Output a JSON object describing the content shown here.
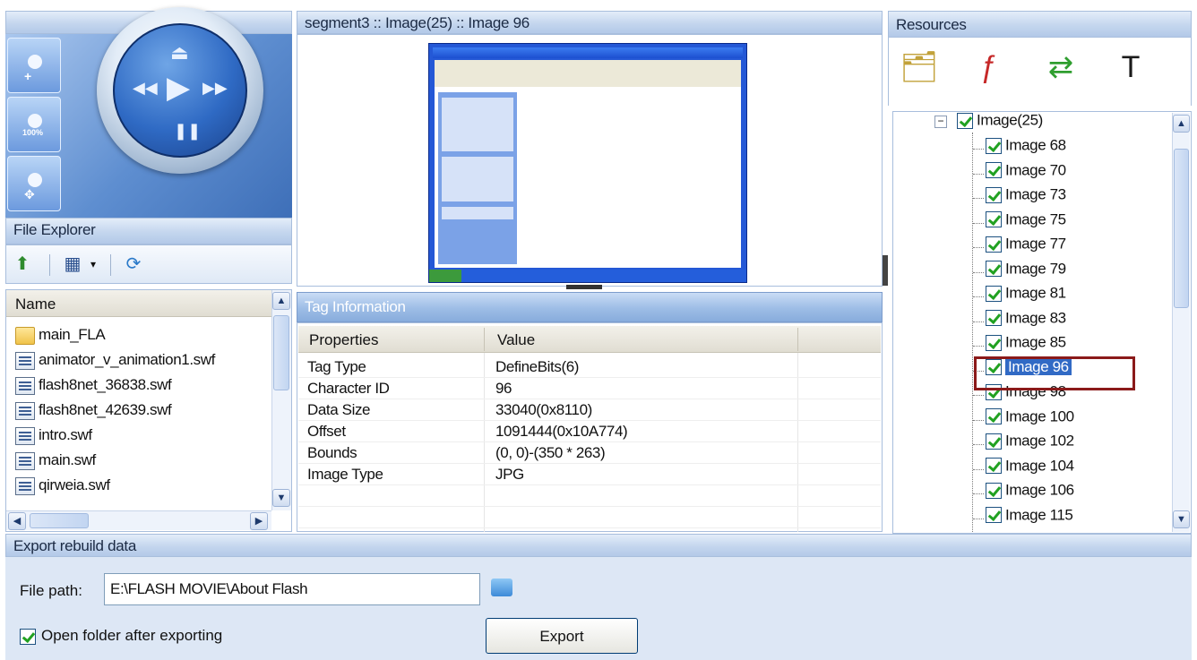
{
  "preview": {
    "title": "segment3 :: Image(25) :: Image 96"
  },
  "resources": {
    "title": "Resources",
    "toolbar_icons": [
      "open-folder-icon",
      "flash-file-icon",
      "refresh-swap-icon",
      "text-properties-icon"
    ],
    "tree": {
      "root_label": "Image(25)",
      "items": [
        "Image 68",
        "Image 70",
        "Image 73",
        "Image 75",
        "Image 77",
        "Image 79",
        "Image 81",
        "Image 83",
        "Image 85",
        "Image 96",
        "Image 98",
        "Image 100",
        "Image 102",
        "Image 104",
        "Image 106",
        "Image 115"
      ],
      "selected": "Image 96"
    }
  },
  "file_explorer": {
    "title": "File Explorer",
    "toolbar_icons": [
      "up-folder-icon",
      "view-mode-icon",
      "refresh-icon"
    ],
    "column_name": "Name",
    "files": [
      {
        "name": "main_FLA",
        "icon": "folder-icon"
      },
      {
        "name": "animator_v_animation1.swf",
        "icon": "swf-file-icon"
      },
      {
        "name": "flash8net_36838.swf",
        "icon": "swf-file-icon"
      },
      {
        "name": "flash8net_42639.swf",
        "icon": "swf-file-icon"
      },
      {
        "name": "intro.swf",
        "icon": "swf-file-icon"
      },
      {
        "name": "main.swf",
        "icon": "swf-file-icon"
      },
      {
        "name": "qirweia.swf",
        "icon": "swf-file-icon"
      }
    ]
  },
  "tag_info": {
    "title": "Tag Information",
    "columns": [
      "Properties",
      "Value"
    ],
    "rows": [
      {
        "property": "Tag Type",
        "value": "DefineBits(6)"
      },
      {
        "property": "Character ID",
        "value": "96"
      },
      {
        "property": "Data Size",
        "value": "33040(0x8110)"
      },
      {
        "property": "Offset",
        "value": "1091444(0x10A774)"
      },
      {
        "property": "Bounds",
        "value": "(0, 0)-(350 * 263)"
      },
      {
        "property": "Image Type",
        "value": "JPG"
      }
    ]
  },
  "export": {
    "title": "Export rebuild data",
    "file_path_label": "File path:",
    "file_path_value": "E:\\FLASH MOVIE\\About Flash",
    "open_folder_label": "Open folder after exporting",
    "open_folder_checked": true,
    "export_button": "Export"
  },
  "colors": {
    "accent": "#316ac5",
    "selection_box": "#8b1a1a",
    "header_blue": "#9dbde6"
  }
}
